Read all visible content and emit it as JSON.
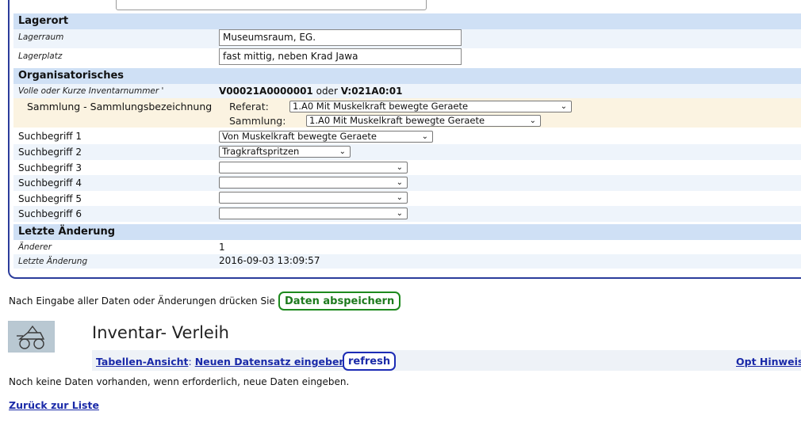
{
  "top_partial_label": "",
  "lagerort": {
    "heading": "Lagerort",
    "lagerraum_label": "Lagerraum",
    "lagerraum_value": "Museumsraum, EG.",
    "lagerplatz_label": "Lagerplatz",
    "lagerplatz_value": "fast mittig, neben Krad Jawa"
  },
  "organisatorisches": {
    "heading": "Organisatorisches",
    "inventar_label": "Volle oder Kurze Inventarnummer '",
    "inventar_full": "V00021A0000001",
    "inventar_or": " oder ",
    "inventar_short": "V:021A0:01",
    "sammlung_label": "Sammlung - Sammlungsbezeichnung",
    "referat_label": "Referat:",
    "referat_value": "1.A0 Mit Muskelkraft bewegte Geraete",
    "sammlung_field_label": "Sammlung:",
    "sammlung_value": "1.A0 Mit Muskelkraft bewegte Geraete",
    "suchbegriffe": [
      {
        "label": "Suchbegriff 1",
        "value": "Von Muskelkraft bewegte Geraete"
      },
      {
        "label": "Suchbegriff 2",
        "value": "Tragkraftspritzen"
      },
      {
        "label": "Suchbegriff 3",
        "value": ""
      },
      {
        "label": "Suchbegriff 4",
        "value": ""
      },
      {
        "label": "Suchbegriff 5",
        "value": ""
      },
      {
        "label": "Suchbegriff 6",
        "value": ""
      }
    ]
  },
  "letzte": {
    "heading": "Letzte Änderung",
    "aenderer_label": "Änderer",
    "aenderer_value": "1",
    "datum_label": "Letzte Änderung",
    "datum_value": "2016-09-03 13:09:57"
  },
  "save_hint": "Nach Eingabe aller Daten oder Änderungen drücken Sie",
  "save_button": "Daten abspeichern",
  "verleih": {
    "title": "Inventar- Verleih",
    "tabellen_link": "Tabellen-Ansicht",
    "colon": ":",
    "neu_link": "Neuen Datensatz eingeben",
    "refresh_button": "refresh",
    "opt_link": "Opt Hinweise",
    "empty_text": "Noch keine Daten vorhanden, wenn erforderlich, neue Daten eingeben."
  },
  "back_link": "Zurück zur Liste"
}
